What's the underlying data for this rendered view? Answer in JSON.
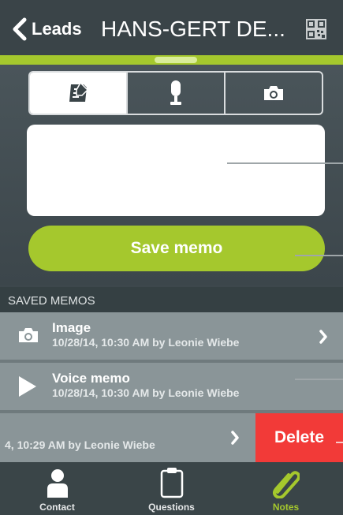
{
  "header": {
    "back_label": "Leads",
    "title": "HANS-GERT DE..."
  },
  "memo_types": [
    {
      "name": "note",
      "icon": "note-icon",
      "active": true
    },
    {
      "name": "voice",
      "icon": "microphone-icon",
      "active": false
    },
    {
      "name": "photo",
      "icon": "camera-icon",
      "active": false
    }
  ],
  "memo": {
    "text": "",
    "save_label": "Save memo"
  },
  "saved_memos": {
    "section_label": "SAVED MEMOS",
    "items": [
      {
        "title": "Image",
        "subtitle": "10/28/14, 10:30 AM by Leonie Wiebe",
        "icon": "camera-icon"
      },
      {
        "title": "Voice memo",
        "subtitle": "10/28/14, 10:30 AM by Leonie Wiebe",
        "icon": "play-icon"
      },
      {
        "title": "",
        "subtitle": "4, 10:29 AM by Leonie Wiebe",
        "icon": ""
      }
    ],
    "delete_label": "Delete"
  },
  "tabbar": {
    "items": [
      {
        "label": "Contact",
        "icon": "person-icon",
        "active": false
      },
      {
        "label": "Questions",
        "icon": "clipboard-icon",
        "active": false
      },
      {
        "label": "Notes",
        "icon": "paperclip-icon",
        "active": true
      }
    ]
  },
  "colors": {
    "accent": "#a5c82d",
    "delete": "#f23a38",
    "header": "#3a4448",
    "row": "#8a9598"
  }
}
